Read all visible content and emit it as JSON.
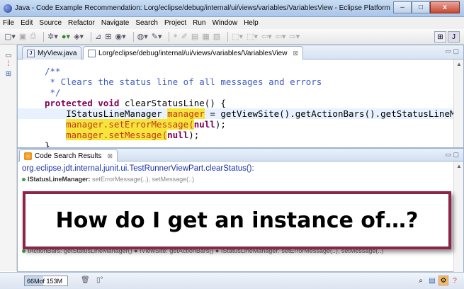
{
  "window": {
    "title": "Java - Code Example Recommendation: Lorg/eclipse/debug/internal/ui/views/variables/VariablesView - Eclipse Platform",
    "minimize": "–",
    "maximize": "□",
    "close": "x"
  },
  "menu": [
    "File",
    "Edit",
    "Source",
    "Refactor",
    "Navigate",
    "Search",
    "Project",
    "Run",
    "Window",
    "Help"
  ],
  "editor": {
    "tabs": [
      {
        "label": "MyView.java",
        "active": false
      },
      {
        "label": "Lorg/eclipse/debug/internal/ui/views/variables/VariablesView",
        "active": true
      }
    ],
    "tab_close": "⊠",
    "code": {
      "l1": "/**",
      "l2": " * Clears the status line of all messages and errors",
      "l3": " */",
      "l4_kw1": "protected",
      "l4_kw2": "void",
      "l4_rest": "clearStatusLine() {",
      "l5_type": "IStatusLineManager ",
      "l5_var": "manager",
      "l5_rest": " = getViewSite().getActionBars().getStatusLineMa",
      "l6_var": "manager",
      "l6_call": ".setErrorMessage(",
      "l6_null": "null",
      "l6_end": ");",
      "l7_var": "manager",
      "l7_call": ".setMessage(",
      "l7_null": "null",
      "l7_end": ");",
      "l8": "}"
    }
  },
  "results": {
    "tab_label": "Code Search Results",
    "tab_close": "⊠",
    "item_link": "org.eclipse.jdt.internal.junit.ui.TestRunnerViewPart.clearStatus():",
    "item_type": "IStatusLineManager:",
    "item_methods": "setErrorMessage(..), setMessage(..)",
    "item2_text": "IActionBars: getStatusLineManager() ● IViewSite: getActionBars() ● IStatusLineManager: setErrorMessage(..), setMessage(..)"
  },
  "callout": {
    "text": "How do I get an instance of…?"
  },
  "statusbar": {
    "heap_used": "66M",
    "heap_total": "of 153M",
    "heap_fraction": 0.43
  }
}
